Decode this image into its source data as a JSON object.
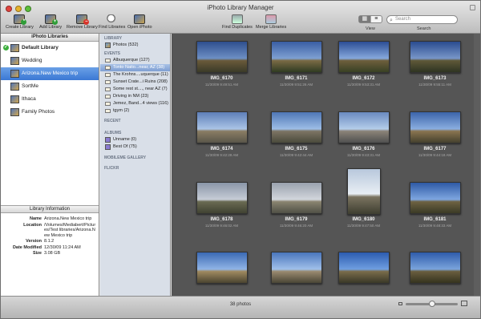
{
  "window": {
    "title": "iPhoto Library Manager"
  },
  "toolbar": {
    "buttons": [
      {
        "label": "Create Library",
        "icon": "create-library-icon"
      },
      {
        "label": "Add Library",
        "icon": "add-library-icon"
      },
      {
        "label": "Remove Library",
        "icon": "remove-library-icon"
      },
      {
        "label": "Find Libraries",
        "icon": "find-libraries-icon"
      },
      {
        "label": "Open iPhoto",
        "icon": "open-iphoto-icon"
      },
      {
        "label": "Find Duplicates",
        "icon": "find-duplicates-icon"
      },
      {
        "label": "Merge Libraries",
        "icon": "merge-libraries-icon"
      }
    ],
    "view_label": "View",
    "search_label": "Search",
    "search_placeholder": "Search"
  },
  "libraries": {
    "header": "iPhoto Libraries",
    "items": [
      {
        "name": "Default Library",
        "bold": true,
        "checked": true
      },
      {
        "name": "Wedding"
      },
      {
        "name": "Arizona.New Mexico trip",
        "selected": true
      },
      {
        "name": "SortMe"
      },
      {
        "name": "Ithaca"
      },
      {
        "name": "Family Photos"
      }
    ]
  },
  "info": {
    "header": "Library Information",
    "name_k": "Name",
    "name_v": "Arizona.New Mexico trip",
    "loc_k": "Location",
    "loc_v": "/Volumes/Mediabert/Pictures/Test libraries/Arizona.New Mexico trip",
    "ver_k": "Version",
    "ver_v": "8.1.2",
    "mod_k": "Date Modified",
    "mod_v": "12/30/09 11:24 AM",
    "size_k": "Size",
    "size_v": "3.08 GB"
  },
  "sources": {
    "library_h": "LIBRARY",
    "photos": "Photos (532)",
    "events_h": "EVENTS",
    "events": [
      "Albuquerque (127)",
      "Tonto Natio...near, AZ (38)",
      "The Krohns....uquerque (11)",
      "Sunset Crate...i Ruins (208)",
      "Some rest st...., near AZ (7)",
      "Driving in NM (23)",
      "Jemez, Band...4 views (116)",
      "tgym (2)"
    ],
    "recent_h": "RECENT",
    "albums_h": "ALBUMS",
    "albums": [
      "Unname (0)",
      "Best Of (75)"
    ],
    "mobileme_h": "MOBILEME GALLERY",
    "flickr_h": "FLICKR"
  },
  "photos": [
    {
      "name": "IMG_6170",
      "date": "11/30/09 9:49:51 AM"
    },
    {
      "name": "IMG_6171",
      "date": "11/30/09 9:51:26 AM"
    },
    {
      "name": "IMG_6172",
      "date": "11/30/09 9:53:31 AM"
    },
    {
      "name": "IMG_6173",
      "date": "11/30/09 9:55:11 AM"
    },
    {
      "name": "IMG_6174",
      "date": "11/30/09 9:42:28 AM"
    },
    {
      "name": "IMG_6175",
      "date": "11/30/09 9:42:44 AM"
    },
    {
      "name": "IMG_6176",
      "date": "11/30/09 9:43:31 AM"
    },
    {
      "name": "IMG_6177",
      "date": "11/30/09 9:44:18 AM"
    },
    {
      "name": "IMG_6178",
      "date": "11/30/09 9:46:02 AM"
    },
    {
      "name": "IMG_6179",
      "date": "11/30/09 9:46:20 AM"
    },
    {
      "name": "IMG_6180",
      "date": "11/30/09 9:47:50 AM"
    },
    {
      "name": "IMG_6181",
      "date": "11/30/09 9:48:33 AM"
    },
    {
      "name": "",
      "date": ""
    },
    {
      "name": "",
      "date": ""
    },
    {
      "name": "",
      "date": ""
    },
    {
      "name": "",
      "date": ""
    }
  ],
  "status": {
    "count": "38 photos",
    "zoom_fraction": 0.5
  }
}
